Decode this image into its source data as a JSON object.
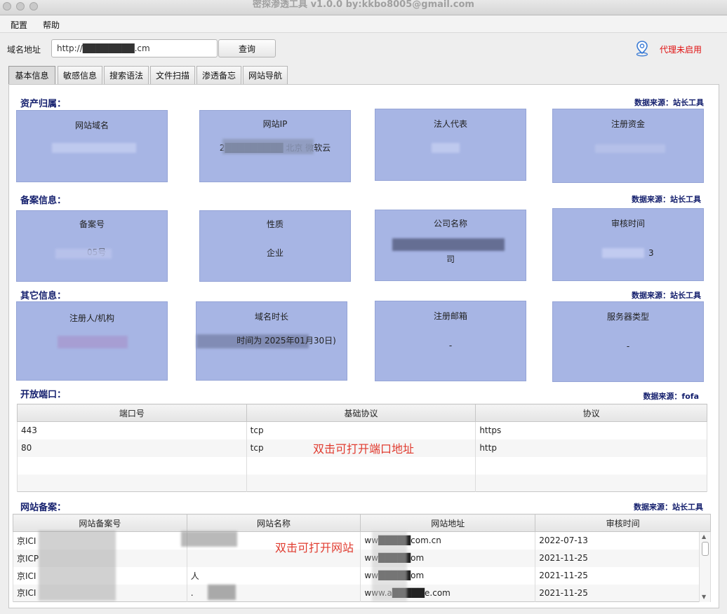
{
  "window": {
    "title": "密探渗透工具  v1.0.0 by:kkbo8005@gmail.com"
  },
  "menu": [
    "配置",
    "帮助"
  ],
  "toolbar": {
    "domain_label": "域名地址",
    "domain_value": "http://████████.cm",
    "query_label": "查询",
    "proxy_status": "代理未启用"
  },
  "tabs": [
    "基本信息",
    "敏感信息",
    "搜索语法",
    "文件扫描",
    "渗透备忘",
    "网站导航"
  ],
  "asset": {
    "title": "资产归属：",
    "source": "数据来源：站长工具",
    "cards": [
      {
        "label": "网站域名",
        "value": ""
      },
      {
        "label": "网站IP",
        "value": "2█████████ 北京 微软云"
      },
      {
        "label": "法人代表",
        "value": ""
      },
      {
        "label": "注册资金",
        "value": ""
      }
    ]
  },
  "beian": {
    "title": "备案信息：",
    "source": "数据来源：站长工具",
    "cards": [
      {
        "label": "备案号",
        "value": "05号"
      },
      {
        "label": "性质",
        "value": "企业"
      },
      {
        "label": "公司名称",
        "value": "司"
      },
      {
        "label": "审核时间",
        "value": "3"
      }
    ]
  },
  "other": {
    "title": "其它信息：",
    "source": "数据来源：站长工具",
    "cards": [
      {
        "label": "注册人/机构",
        "value": ""
      },
      {
        "label": "域名时长",
        "value": "时间为 2025年01月30日)"
      },
      {
        "label": "注册邮箱",
        "value": "-"
      },
      {
        "label": "服务器类型",
        "value": "-"
      }
    ]
  },
  "ports": {
    "title": "开放端口：",
    "source": "数据来源：fofa",
    "columns": [
      "端口号",
      "基础协议",
      "协议"
    ],
    "rows": [
      [
        "443",
        "tcp",
        "https"
      ],
      [
        "80",
        "tcp",
        "http"
      ],
      [
        "",
        "",
        ""
      ],
      [
        "",
        "",
        ""
      ]
    ],
    "hint": "双击可打开端口地址"
  },
  "icp": {
    "title": "网站备案：",
    "source": "数据来源：站长工具",
    "columns": [
      "网站备案号",
      "网站名称",
      "网站地址",
      "审核时间"
    ],
    "rows": [
      [
        "京ICI",
        "",
        "ww█████com.cn",
        "2022-07-13"
      ],
      [
        "京ICP",
        "",
        "ww█████om",
        "2021-11-25"
      ],
      [
        "京ICI",
        "人",
        "ww█████om",
        "2021-11-25"
      ],
      [
        "京ICI",
        ".",
        "www.a█████e.com",
        "2021-11-25"
      ]
    ],
    "hint": "双击可打开网站"
  }
}
